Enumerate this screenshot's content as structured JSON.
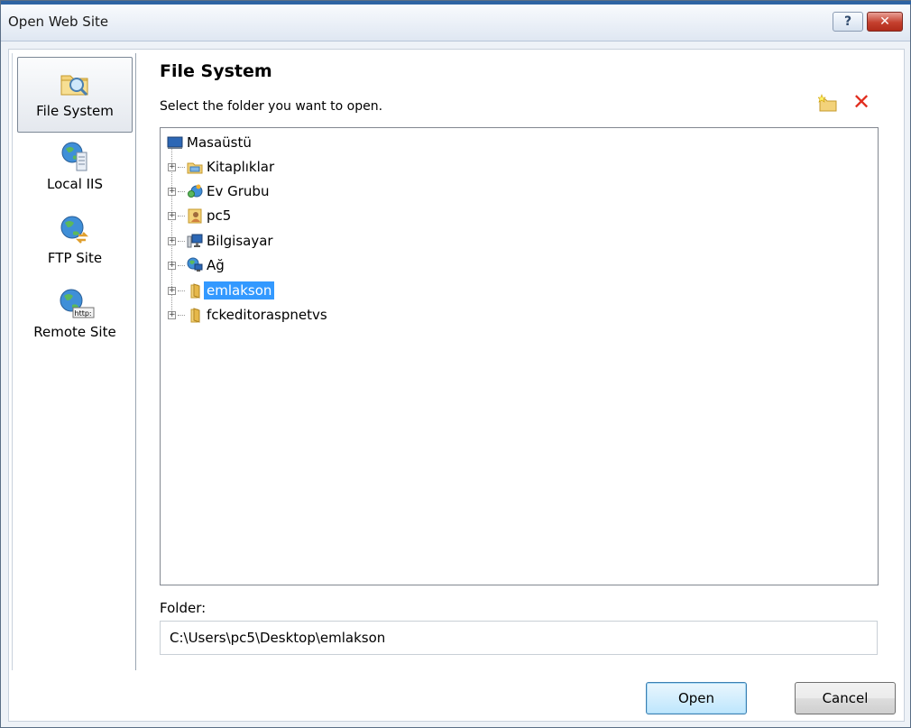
{
  "window": {
    "title": "Open Web Site",
    "help_label": "?",
    "close_label": "✕"
  },
  "sidebar": {
    "items": [
      {
        "label": "File System",
        "icon": "folder-search-icon",
        "selected": true
      },
      {
        "label": "Local IIS",
        "icon": "server-globe-icon",
        "selected": false
      },
      {
        "label": "FTP Site",
        "icon": "globe-transfer-icon",
        "selected": false
      },
      {
        "label": "Remote Site",
        "icon": "globe-http-icon",
        "selected": false
      }
    ]
  },
  "main": {
    "heading": "File System",
    "subheading": "Select the folder you want to open.",
    "tree": {
      "root": {
        "label": "Masaüstü",
        "icon": "desktop-icon"
      },
      "children": [
        {
          "label": "Kitaplıklar",
          "icon": "libraries-icon"
        },
        {
          "label": "Ev Grubu",
          "icon": "homegroup-icon"
        },
        {
          "label": "pc5",
          "icon": "user-folder-icon"
        },
        {
          "label": "Bilgisayar",
          "icon": "computer-icon"
        },
        {
          "label": "Ağ",
          "icon": "network-icon"
        },
        {
          "label": "emlakson",
          "icon": "folder-icon",
          "selected": true
        },
        {
          "label": "fckeditoraspnetvs",
          "icon": "folder-icon"
        }
      ]
    },
    "folder_label": "Folder:",
    "folder_value": "C:\\Users\\pc5\\Desktop\\emlakson"
  },
  "buttons": {
    "open": "Open",
    "cancel": "Cancel"
  },
  "colors": {
    "selection": "#3399ff",
    "delete": "#e12d1e",
    "title_accent": "#2d63a3"
  }
}
